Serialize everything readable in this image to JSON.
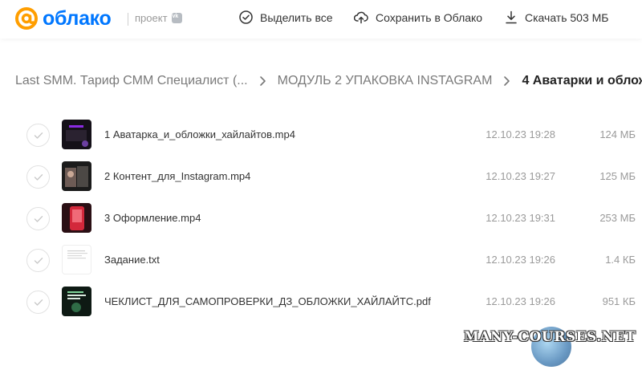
{
  "header": {
    "logo_text": "облако",
    "project_label": "проект",
    "actions": {
      "select_all": "Выделить все",
      "save_to_cloud": "Сохранить в Облако",
      "download": "Скачать 503 МБ"
    }
  },
  "breadcrumb": [
    {
      "label": "Last SMM. Тариф СММ Специалист (...",
      "current": false
    },
    {
      "label": "МОДУЛЬ 2 УПАКОВКА INSTAGRAM",
      "current": false
    },
    {
      "label": "4 Аватарки и облож",
      "current": true
    }
  ],
  "files": [
    {
      "name": "1 Аватарка_и_обложки_хайлайтов.mp4",
      "date": "12.10.23 19:28",
      "size": "124 МБ",
      "thumb": "video-dark"
    },
    {
      "name": "2 Контент_для_Instagram.mp4",
      "date": "12.10.23 19:27",
      "size": "125 МБ",
      "thumb": "video-photo"
    },
    {
      "name": "3 Оформление.mp4",
      "date": "12.10.23 19:31",
      "size": "253 МБ",
      "thumb": "video-red"
    },
    {
      "name": "Задание.txt",
      "date": "12.10.23 19:26",
      "size": "1.4 КБ",
      "thumb": "text-doc"
    },
    {
      "name": "ЧЕКЛИСТ_ДЛЯ_САМОПРОВЕРКИ_ДЗ_ОБЛОЖКИ_ХАЙЛАЙТС.pdf",
      "date": "12.10.23 19:26",
      "size": "951 КБ",
      "thumb": "pdf-dark"
    }
  ],
  "watermark": "MANY-COURSES.NET",
  "colors": {
    "brand": "#0077ff",
    "logo_at": "#ff9e00"
  }
}
